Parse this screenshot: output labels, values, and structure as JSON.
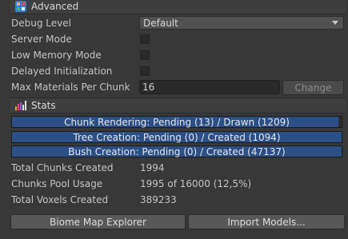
{
  "advanced": {
    "title": "Advanced",
    "icon": "voxel-plugin-icon",
    "debug_level": {
      "label": "Debug Level",
      "value": "Default"
    },
    "server_mode": {
      "label": "Server Mode",
      "checked": false
    },
    "low_memory_mode": {
      "label": "Low Memory Mode",
      "checked": false
    },
    "delayed_initialization": {
      "label": "Delayed Initialization",
      "checked": false
    },
    "max_materials": {
      "label": "Max Materials Per Chunk",
      "value": "16",
      "change_label": "Change"
    }
  },
  "stats": {
    "title": "Stats",
    "icon": "bar-chart-icon",
    "bars": [
      {
        "label": "Chunk Rendering: Pending (13) / Drawn (1209)",
        "progress": 0.99
      },
      {
        "label": "Tree Creation: Pending (0) / Created (1094)",
        "progress": 1.0
      },
      {
        "label": "Bush Creation: Pending (0) / Created (47137)",
        "progress": 1.0
      }
    ],
    "total_chunks": {
      "label": "Total Chunks Created",
      "value": "1994"
    },
    "chunks_pool": {
      "label": "Chunks Pool Usage",
      "value": "1995 of 16000 (12,5%)"
    },
    "total_voxels": {
      "label": "Total Voxels Created",
      "value": "389233"
    }
  },
  "buttons": {
    "biome_map": "Biome Map Explorer",
    "import_models": "Import Models..."
  },
  "colors": {
    "background": "#383838",
    "progress_fill": "#2b4f86"
  }
}
